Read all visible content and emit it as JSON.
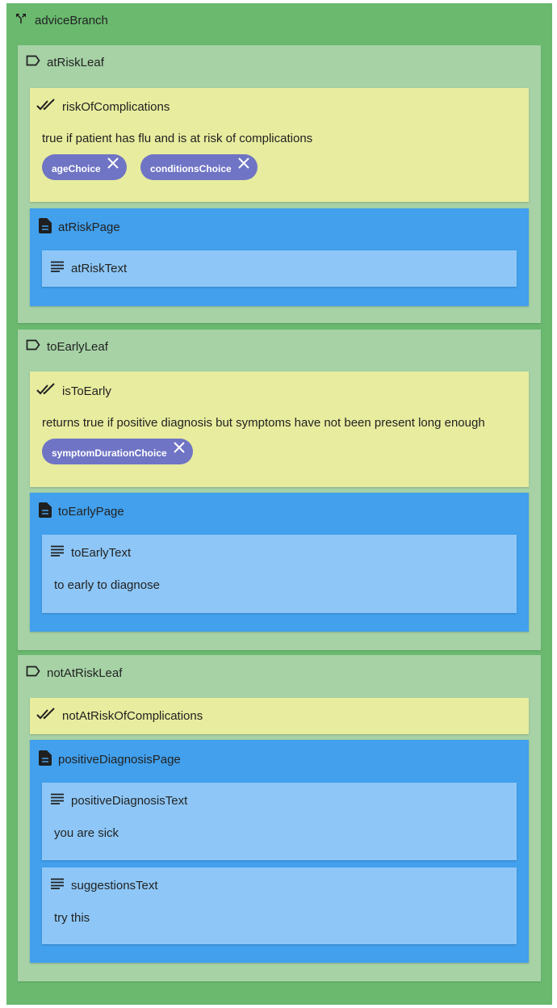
{
  "branch": {
    "name": "adviceBranch",
    "icon": "branch-icon"
  },
  "leaves": [
    {
      "name": "atRiskLeaf",
      "icon": "label-icon",
      "condition": {
        "name": "riskOfComplications",
        "description": "true if patient has flu and is at risk of complications",
        "choices": [
          "ageChoice",
          "conditionsChoice"
        ]
      },
      "page": {
        "name": "atRiskPage",
        "texts": [
          {
            "name": "atRiskText",
            "content": ""
          }
        ]
      }
    },
    {
      "name": "toEarlyLeaf",
      "icon": "label-icon",
      "condition": {
        "name": "isToEarly",
        "description": "returns true if positive diagnosis but symptoms have not been present long enough",
        "choices": [
          "symptomDurationChoice"
        ]
      },
      "page": {
        "name": "toEarlyPage",
        "texts": [
          {
            "name": "toEarlyText",
            "content": "to early to diagnose"
          }
        ]
      }
    },
    {
      "name": "notAtRiskLeaf",
      "icon": "label-icon",
      "condition": {
        "name": "notAtRiskOfComplications"
      },
      "page": {
        "name": "positiveDiagnosisPage",
        "texts": [
          {
            "name": "positiveDiagnosisText",
            "content": "you are sick"
          },
          {
            "name": "suggestionsText",
            "content": "try this"
          }
        ]
      }
    }
  ],
  "colors": {
    "branch": "#6ab96f",
    "leaf": "#a6d2a6",
    "condition": "#e8ec9e",
    "page": "#42a0ec",
    "text": "#8ec7f7",
    "chip": "#6f74c4"
  }
}
